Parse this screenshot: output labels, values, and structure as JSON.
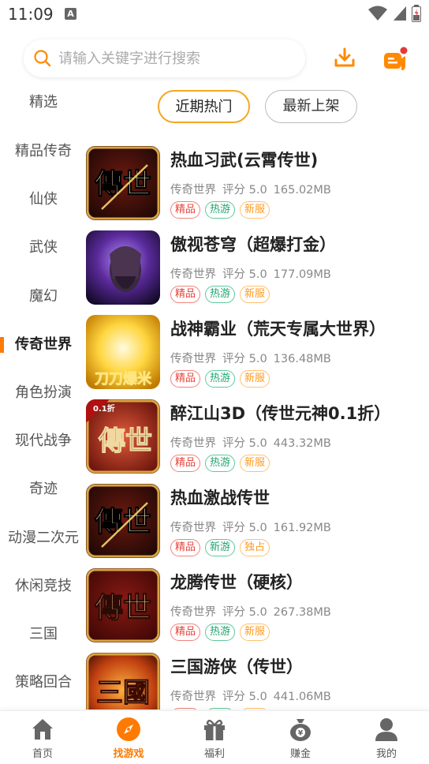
{
  "status": {
    "time": "11:09",
    "notification_letter": "A"
  },
  "search": {
    "placeholder": "请输入关键字进行搜索"
  },
  "sidebar": {
    "items": [
      {
        "label": "精选"
      },
      {
        "label": "精品传奇"
      },
      {
        "label": "仙侠"
      },
      {
        "label": "武侠"
      },
      {
        "label": "魔幻"
      },
      {
        "label": "传奇世界"
      },
      {
        "label": "角色扮演"
      },
      {
        "label": "现代战争"
      },
      {
        "label": "奇迹"
      },
      {
        "label": "动漫二次元"
      },
      {
        "label": "休闲竞技"
      },
      {
        "label": "三国"
      },
      {
        "label": "策略回合"
      }
    ],
    "active_index": 5
  },
  "tabs": {
    "hot": "近期热门",
    "new": "最新上架"
  },
  "games": [
    {
      "title": "热血习武(云霄传世)",
      "category": "传奇世界",
      "rating": "评分 5.0",
      "size": "165.02MB",
      "tags": [
        "精品",
        "热游",
        "新服"
      ],
      "tag_styles": [
        "red",
        "green",
        "orange"
      ],
      "icon_text": "傳世",
      "icon_style": "dark-red"
    },
    {
      "title": "傲视苍穹（超爆打金）",
      "category": "传奇世界",
      "rating": "评分 5.0",
      "size": "177.09MB",
      "tags": [
        "精品",
        "热游",
        "新服"
      ],
      "tag_styles": [
        "red",
        "green",
        "orange"
      ],
      "icon_text": "",
      "icon_style": "purple"
    },
    {
      "title": "战神霸业（荒天专属大世界）",
      "category": "传奇世界",
      "rating": "评分 5.0",
      "size": "136.48MB",
      "tags": [
        "精品",
        "热游",
        "新服"
      ],
      "tag_styles": [
        "red",
        "green",
        "orange"
      ],
      "icon_text": "刀刀爆米",
      "icon_style": "gold"
    },
    {
      "title": "醉江山3D（传世元神0.1折）",
      "category": "传奇世界",
      "rating": "评分 5.0",
      "size": "443.32MB",
      "tags": [
        "精品",
        "热游",
        "新服"
      ],
      "tag_styles": [
        "red",
        "green",
        "orange"
      ],
      "icon_text": "傳世",
      "icon_badge": "0.1折",
      "icon_style": "red"
    },
    {
      "title": "热血激战传世",
      "category": "传奇世界",
      "rating": "评分 5.0",
      "size": "161.92MB",
      "tags": [
        "精品",
        "新游",
        "独占"
      ],
      "tag_styles": [
        "red",
        "green",
        "orange"
      ],
      "icon_text": "傳世",
      "icon_style": "dark-red"
    },
    {
      "title": "龙腾传世（硬核）",
      "category": "传奇世界",
      "rating": "评分 5.0",
      "size": "267.38MB",
      "tags": [
        "精品",
        "热游",
        "新服"
      ],
      "tag_styles": [
        "red",
        "green",
        "orange"
      ],
      "icon_text": "傳世",
      "icon_style": "maroon"
    },
    {
      "title": "三国游侠（传世）",
      "category": "传奇世界",
      "rating": "评分 5.0",
      "size": "441.06MB",
      "tags": [
        "精品",
        "热游",
        "新服"
      ],
      "tag_styles": [
        "red",
        "green",
        "orange"
      ],
      "icon_text": "三國",
      "icon_style": "fire"
    }
  ],
  "nav": [
    {
      "label": "首页",
      "icon": "home-icon"
    },
    {
      "label": "找游戏",
      "icon": "compass-icon",
      "active": true
    },
    {
      "label": "福利",
      "icon": "gift-icon"
    },
    {
      "label": "赚金",
      "icon": "money-bag-icon"
    },
    {
      "label": "我的",
      "icon": "user-icon"
    }
  ],
  "colors": {
    "accent": "#ff7a00",
    "tag_red": "#e6453c",
    "tag_green": "#1fa56f",
    "tag_orange": "#ff9a1f"
  }
}
